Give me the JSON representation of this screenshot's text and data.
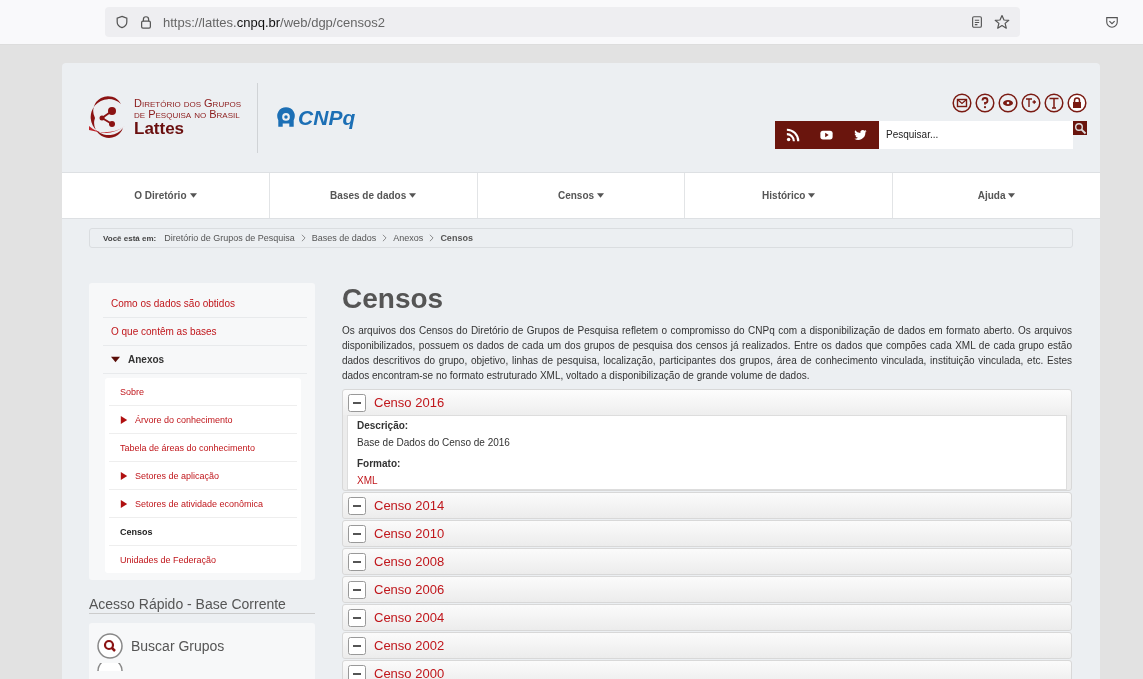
{
  "browser": {
    "url_prefix": "https://lattes.",
    "url_domain": "cnpq.br",
    "url_path": "/web/dgp/censos2"
  },
  "header": {
    "logo_line_1": "Diretório dos Grupos",
    "logo_line_2": "de Pesquisa no Brasil",
    "logo_name": "Lattes",
    "partner_logo": "CNPq",
    "search": {
      "placeholder": "Pesquisar..."
    }
  },
  "nav": [
    {
      "label": "O Diretório"
    },
    {
      "label": "Bases de dados"
    },
    {
      "label": "Censos"
    },
    {
      "label": "Histórico"
    },
    {
      "label": "Ajuda"
    }
  ],
  "breadcrumb": {
    "label": "Você está em:",
    "items": [
      "Diretório de Grupos de Pesquisa",
      "Bases de dados",
      "Anexos",
      "Censos"
    ]
  },
  "sidebar": {
    "items": [
      {
        "label": "Como os dados são obtidos",
        "selected": false,
        "kind": "leaf"
      },
      {
        "label": "O que contêm as bases",
        "selected": false,
        "kind": "leaf"
      },
      {
        "label": "Anexos",
        "selected": false,
        "kind": "branch",
        "expanded": true,
        "children": [
          {
            "label": "Sobre",
            "selected": false,
            "kind": "leaf"
          },
          {
            "label": "Árvore do conhecimento",
            "selected": false,
            "kind": "branch",
            "expanded": false
          },
          {
            "label": "Tabela de áreas do conhecimento",
            "selected": false,
            "kind": "leaf"
          },
          {
            "label": "Setores de aplicação",
            "selected": false,
            "kind": "branch",
            "expanded": false
          },
          {
            "label": "Setores de atividade econômica",
            "selected": false,
            "kind": "branch",
            "expanded": false
          },
          {
            "label": "Censos",
            "selected": true,
            "kind": "leaf"
          },
          {
            "label": "Unidades de Federação",
            "selected": false,
            "kind": "leaf"
          }
        ]
      }
    ]
  },
  "quick_access": {
    "title": "Acesso Rápido - Base Corrente",
    "items": [
      "Buscar Grupos"
    ]
  },
  "main": {
    "title": "Censos",
    "intro": "Os arquivos dos Censos do Diretório de Grupos de Pesquisa refletem o compromisso do CNPq com a disponibilização de dados em formato aberto. Os arquivos disponibilizados, possuem os dados de cada um dos grupos de pesquisa dos censos já realizados. Entre os dados que compões cada XML de cada grupo estão dados descritivos do grupo, objetivo, linhas de pesquisa, localização, participantes dos grupos, área de conhecimento vinculada, instituição vinculada, etc. Estes dados encontram-se no formato estruturado XML, voltado a disponibilização de grande volume de dados.",
    "censuses": [
      {
        "title": "Censo 2016",
        "expanded": true,
        "description_label": "Descrição:",
        "description": "Base de Dados do Censo de 2016",
        "format_label": "Formato:",
        "format": "XML"
      },
      {
        "title": "Censo 2014",
        "expanded": false
      },
      {
        "title": "Censo 2010",
        "expanded": false
      },
      {
        "title": "Censo 2008",
        "expanded": false
      },
      {
        "title": "Censo 2006",
        "expanded": false
      },
      {
        "title": "Censo 2004",
        "expanded": false
      },
      {
        "title": "Censo 2002",
        "expanded": false
      },
      {
        "title": "Censo 2000",
        "expanded": false
      }
    ]
  }
}
